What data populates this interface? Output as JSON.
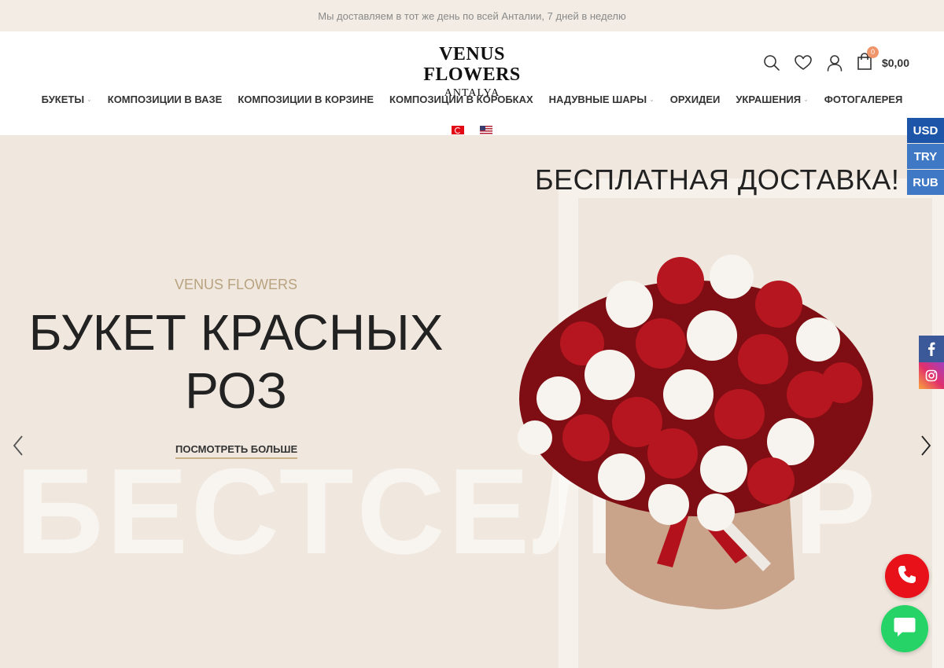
{
  "topbar": {
    "text": "Мы доставляем в тот же день по всей Анталии, 7 дней в неделю"
  },
  "logo": {
    "line1": "VENUS FLOWERS",
    "line2": "ANTALYA"
  },
  "header": {
    "icons": [
      "search-icon",
      "heart-icon",
      "user-icon",
      "shopping-bag-icon"
    ],
    "cart_count": "0",
    "cart_total": "$0,00"
  },
  "nav": {
    "items": [
      {
        "label": "БУКЕТЫ",
        "has_dropdown": true
      },
      {
        "label": "КОМПОЗИЦИИ В ВАЗЕ",
        "has_dropdown": false
      },
      {
        "label": "КОМПОЗИЦИИ В КОРЗИНЕ",
        "has_dropdown": false
      },
      {
        "label": "КОМПОЗИЦИИ В КОРОБКАХ",
        "has_dropdown": false
      },
      {
        "label": "НАДУВНЫЕ ШАРЫ",
        "has_dropdown": true
      },
      {
        "label": "ОРХИДЕИ",
        "has_dropdown": false
      },
      {
        "label": "УКРАШЕНИЯ",
        "has_dropdown": true
      },
      {
        "label": "ФОТОГАЛЕРЕЯ",
        "has_dropdown": false
      }
    ],
    "dropdown_icon": "chevron-down-icon"
  },
  "languages": [
    "turkish-flag-icon",
    "us-flag-icon"
  ],
  "hero": {
    "free_delivery": "БЕСПЛАТНАЯ ДОСТАВКА!",
    "subtitle": "VENUS FLOWERS",
    "title_line1": "БУКЕТ КРАСНЫХ",
    "title_line2": "РОЗ",
    "more_link": "ПОСМОТРЕТЬ БОЛЬШЕ",
    "bg_word": "БЕСТСЕЛЛЕР",
    "prev_icon": "chevron-left-icon",
    "next_icon": "chevron-right-icon"
  },
  "currency": {
    "options": [
      "USD",
      "TRY",
      "RUB"
    ],
    "selected": "USD"
  },
  "social": [
    "facebook-icon",
    "instagram-icon"
  ],
  "floating": {
    "call_icon": "phone-icon",
    "chat_icon": "chat-icon"
  },
  "colors": {
    "topbar_bg": "#f2ece4",
    "hero_bg": "#f0e8df",
    "accent_gold": "#b8a27f",
    "currency_blue": "#3f78c4",
    "call_red": "#e8111a",
    "chat_green": "#25d366"
  }
}
